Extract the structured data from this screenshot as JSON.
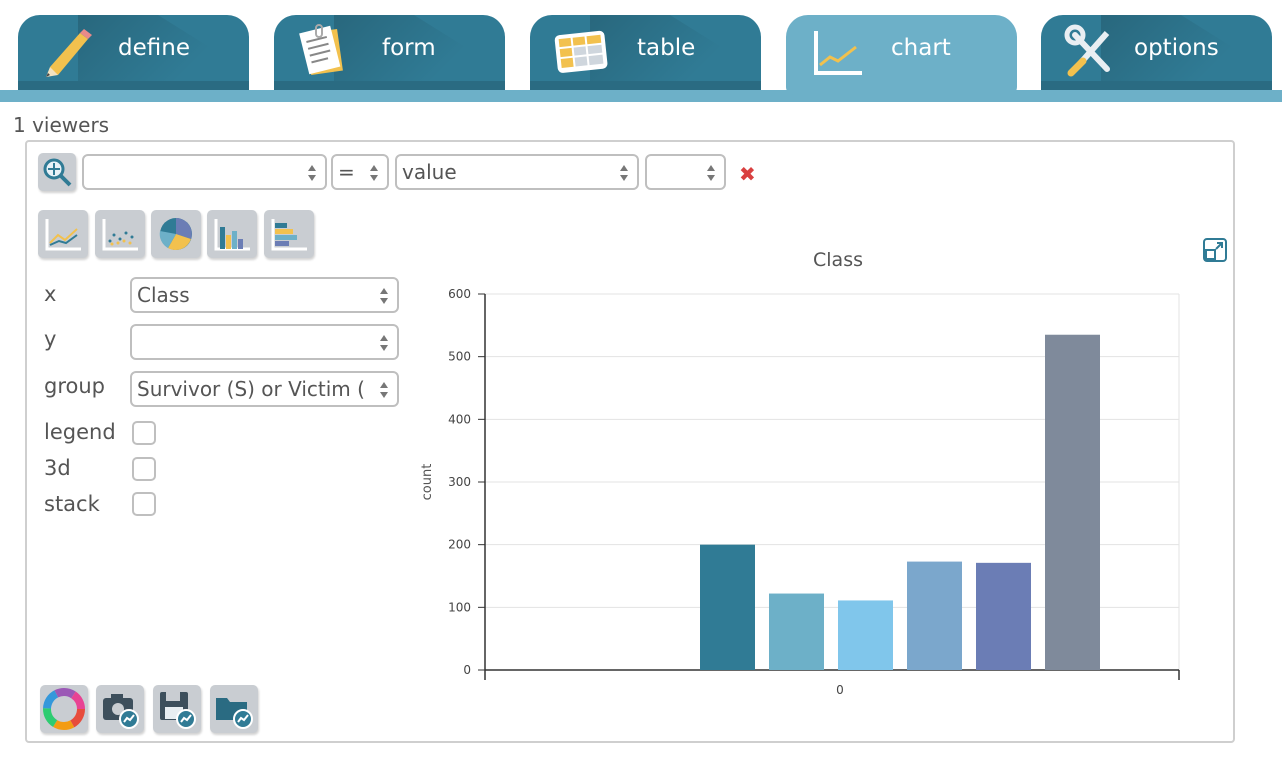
{
  "tabs": [
    {
      "label": "define",
      "icon": "pencil-icon"
    },
    {
      "label": "form",
      "icon": "notepad-icon"
    },
    {
      "label": "table",
      "icon": "table-icon"
    },
    {
      "label": "chart",
      "icon": "line-chart-icon",
      "active": true
    },
    {
      "label": "options",
      "icon": "tools-icon"
    }
  ],
  "viewers_label": "1 viewers",
  "filter": {
    "field_value": "",
    "operator": "=",
    "value_field": "value",
    "extra": ""
  },
  "form": {
    "x_label": "x",
    "x_value": "Class",
    "y_label": "y",
    "y_value": "",
    "group_label": "group",
    "group_value": "Survivor (S) or Victim (",
    "legend_label": "legend",
    "threed_label": "3d",
    "stack_label": "stack"
  },
  "colors": {
    "tab": "#307b95",
    "tab_active": "#6db0c8"
  },
  "chart_data": {
    "type": "bar",
    "title": "Class",
    "ylabel": "count",
    "xlabel": "",
    "categories": [
      "0"
    ],
    "series": [
      {
        "values": [
          200
        ],
        "color": "#307b95"
      },
      {
        "values": [
          122
        ],
        "color": "#6db0c8"
      },
      {
        "values": [
          111
        ],
        "color": "#80c6eb"
      },
      {
        "values": [
          173
        ],
        "color": "#7ba7cc"
      },
      {
        "values": [
          171
        ],
        "color": "#6b7db5"
      },
      {
        "values": [
          535
        ],
        "color": "#7f8a9b"
      }
    ],
    "ylim": [
      0,
      600
    ],
    "yticks": [
      0,
      100,
      200,
      300,
      400,
      500,
      600
    ],
    "grid": true
  }
}
